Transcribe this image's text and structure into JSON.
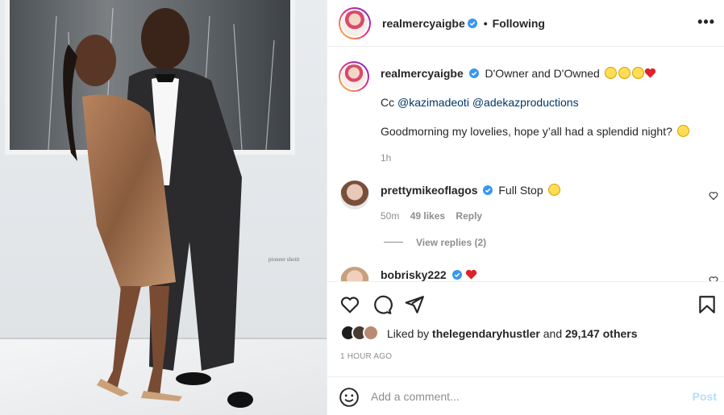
{
  "photo": {
    "watermark": "pioneer shotit"
  },
  "header": {
    "username": "realmercyaigbe",
    "separator": "•",
    "follow_status": "Following",
    "more_icon": "more-horizontal-icon"
  },
  "caption": {
    "username": "realmercyaigbe",
    "line1": "D'Owner and D'Owned",
    "line1_emojis": [
      "laughing-emoji",
      "laughing-emoji",
      "star-struck-emoji",
      "red-heart-emoji"
    ],
    "line2_prefix": "Cc",
    "mention1": "@kazimadeoti",
    "mention2": "@adekazproductions",
    "line3": "Goodmorning my lovelies, hope y’all had a splendid night?",
    "line3_emoji": "winking-kiss-emoji",
    "time": "1h"
  },
  "comments": [
    {
      "username": "prettymikeoflagos",
      "text": "Full Stop",
      "emoji": "star-struck-emoji",
      "time": "50m",
      "likes": "49 likes",
      "reply_label": "Reply",
      "view_replies": "View replies (2)"
    },
    {
      "username": "bobrisky222",
      "emoji": "red-heart-emoji"
    }
  ],
  "actions": {
    "like_icon": "heart-icon",
    "comment_icon": "comment-icon",
    "share_icon": "paper-plane-icon",
    "save_icon": "bookmark-icon"
  },
  "likes": {
    "prefix": "Liked by",
    "user": "thelegendaryhustler",
    "conj": "and",
    "count": "29,147 others"
  },
  "timestamp": "1 HOUR AGO",
  "add_comment": {
    "placeholder": "Add a comment...",
    "post_label": "Post",
    "emoji_icon": "smiley-icon"
  },
  "colors": {
    "link": "#00376b",
    "verified": "#3897f0",
    "post_disabled": "#b2dffc",
    "muted": "#8e8e8e"
  }
}
